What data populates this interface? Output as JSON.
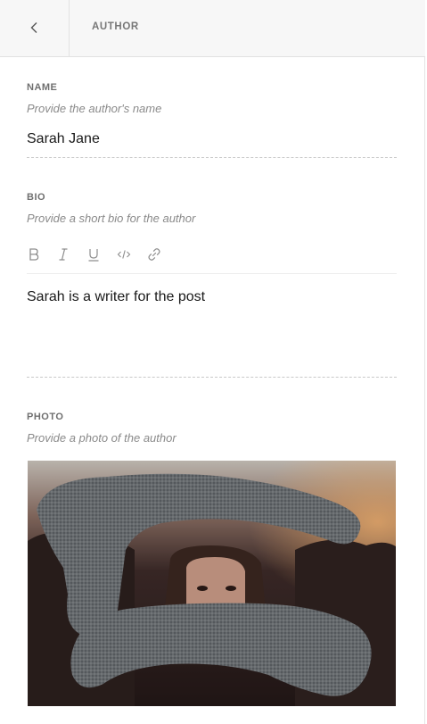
{
  "header": {
    "title": "AUTHOR"
  },
  "name": {
    "label": "NAME",
    "hint": "Provide the author's name",
    "value": "Sarah Jane"
  },
  "bio": {
    "label": "BIO",
    "hint": "Provide a short bio for the author",
    "toolbar": [
      "bold",
      "italic",
      "underline",
      "code",
      "link"
    ],
    "value": "Sarah is a writer for the post"
  },
  "photo": {
    "label": "PHOTO",
    "hint": "Provide a photo of the author"
  }
}
